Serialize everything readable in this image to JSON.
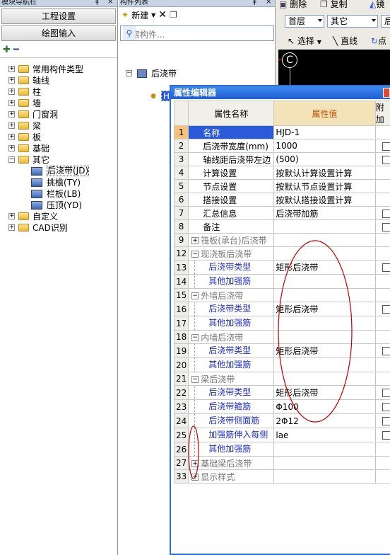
{
  "nav": {
    "title": "模块导航栏",
    "buttons": [
      "工程设置",
      "绘图输入"
    ],
    "tree": [
      {
        "label": "常用构件类型",
        "sign": "+"
      },
      {
        "label": "轴线",
        "sign": "+"
      },
      {
        "label": "柱",
        "sign": "+"
      },
      {
        "label": "墙",
        "sign": "+"
      },
      {
        "label": "门窗洞",
        "sign": "+"
      },
      {
        "label": "梁",
        "sign": "+"
      },
      {
        "label": "板",
        "sign": "+"
      },
      {
        "label": "基础",
        "sign": "+"
      },
      {
        "label": "其它",
        "sign": "-"
      },
      {
        "label": "后浇带(JD)",
        "child": true,
        "selected": true
      },
      {
        "label": "挑檐(TY)",
        "child": true
      },
      {
        "label": "栏板(LB)",
        "child": true
      },
      {
        "label": "压顶(YD)",
        "child": true
      },
      {
        "label": "自定义",
        "sign": "+"
      },
      {
        "label": "CAD识别",
        "sign": "+"
      }
    ]
  },
  "clist": {
    "title": "构件列表",
    "new_label": "新建",
    "search_placeholder": "搜索构件...",
    "root": "后浇带",
    "item": "HJD-1"
  },
  "toolbar": {
    "delete": "删除",
    "copy": "复制",
    "mirror": "镜",
    "floor": "首层",
    "layer": "其它",
    "more": "后",
    "select": "选择",
    "line": "直线",
    "point": "点",
    "canvas_letter": "C"
  },
  "pe": {
    "title": "属性编辑器",
    "headers": [
      "属性名称",
      "属性值",
      "附加"
    ],
    "rows": [
      {
        "n": "1",
        "name": "名称",
        "val": "HJD-1",
        "type": "sel",
        "cb": false
      },
      {
        "n": "2",
        "name": "后浇带宽度(mm)",
        "val": "1000",
        "cb": true
      },
      {
        "n": "3",
        "name": "轴线距后浇带左边",
        "val": "(500)",
        "cb": true
      },
      {
        "n": "4",
        "name": "计算设置",
        "val": "按默认计算设置计算",
        "cb": false
      },
      {
        "n": "5",
        "name": "节点设置",
        "val": "按默认节点设置计算",
        "cb": false
      },
      {
        "n": "6",
        "name": "搭接设置",
        "val": "按默认搭接设置计算",
        "cb": false
      },
      {
        "n": "7",
        "name": "汇总信息",
        "val": "后浇带加筋",
        "cb": true
      },
      {
        "n": "8",
        "name": "备注",
        "val": "",
        "cb": true
      },
      {
        "n": "9",
        "name": "筏板(承台)后浇带",
        "val": "",
        "type": "grp",
        "sign": "+"
      },
      {
        "n": "12",
        "name": "现浇板后浇带",
        "val": "",
        "type": "grp",
        "sign": "-"
      },
      {
        "n": "13",
        "name": "后浇带类型",
        "val": "矩形后浇带",
        "type": "sub",
        "cb": true
      },
      {
        "n": "14",
        "name": "其他加强筋",
        "val": "",
        "type": "sub"
      },
      {
        "n": "15",
        "name": "外墙后浇带",
        "val": "",
        "type": "grp",
        "sign": "-"
      },
      {
        "n": "16",
        "name": "后浇带类型",
        "val": "矩形后浇带",
        "type": "sub",
        "cb": true
      },
      {
        "n": "17",
        "name": "其他加强筋",
        "val": "",
        "type": "sub"
      },
      {
        "n": "18",
        "name": "内墙后浇带",
        "val": "",
        "type": "grp",
        "sign": "-"
      },
      {
        "n": "19",
        "name": "后浇带类型",
        "val": "矩形后浇带",
        "type": "sub",
        "cb": true
      },
      {
        "n": "20",
        "name": "其他加强筋",
        "val": "",
        "type": "sub"
      },
      {
        "n": "21",
        "name": "梁后浇带",
        "val": "",
        "type": "grp",
        "sign": "-"
      },
      {
        "n": "22",
        "name": "后浇带类型",
        "val": "矩形后浇带",
        "type": "sub",
        "cb": true
      },
      {
        "n": "23",
        "name": "后浇带箍筋",
        "val": "Φ100",
        "type": "sub",
        "cb": true
      },
      {
        "n": "24",
        "name": "后浇带侧面筋",
        "val": "2Φ12",
        "type": "sub",
        "cb": true
      },
      {
        "n": "25",
        "name": "加强筋伸入每侧",
        "val": "lae",
        "type": "sub",
        "cb": true
      },
      {
        "n": "26",
        "name": "其他加强筋",
        "val": "",
        "type": "sub"
      },
      {
        "n": "27",
        "name": "基础梁后浇带",
        "val": "",
        "type": "grp",
        "sign": "+"
      },
      {
        "n": "33",
        "name": "显示样式",
        "val": "",
        "type": "grp",
        "sign": "+"
      }
    ]
  },
  "colors": {
    "title_bar": "#1f5ed4",
    "sub_text": "#1f2fc8",
    "annotation": "#c00000"
  }
}
